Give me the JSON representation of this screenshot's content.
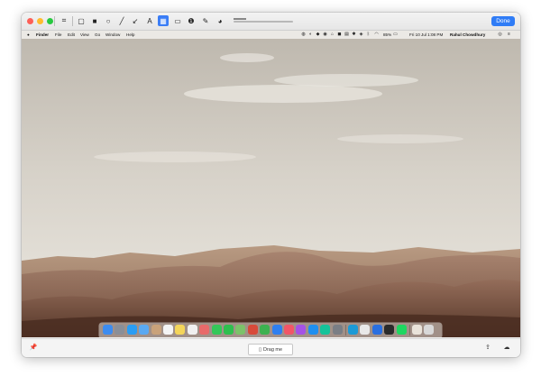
{
  "toolbar": {
    "done_label": "Done",
    "tools": [
      {
        "name": "crop-icon",
        "glyph": "⌗"
      },
      {
        "name": "rectangle-outline-icon",
        "glyph": "▢"
      },
      {
        "name": "rectangle-filled-icon",
        "glyph": "■"
      },
      {
        "name": "ellipse-icon",
        "glyph": "○"
      },
      {
        "name": "line-icon",
        "glyph": "╱"
      },
      {
        "name": "arrow-icon",
        "glyph": "↙"
      },
      {
        "name": "text-icon",
        "glyph": "A"
      },
      {
        "name": "blur-icon",
        "glyph": "▦"
      },
      {
        "name": "highlight-icon",
        "glyph": "▭"
      },
      {
        "name": "counter-icon",
        "glyph": "❶"
      },
      {
        "name": "pencil-icon",
        "glyph": "✎"
      },
      {
        "name": "color-picker-icon",
        "glyph": "◕"
      }
    ]
  },
  "menubar": {
    "apple": "",
    "app_name": "Finder",
    "items": [
      "File",
      "Edit",
      "View",
      "Go",
      "Window",
      "Help"
    ],
    "battery": "85%",
    "datetime": "Fri 10 Jul  1:08 PM",
    "user": "Rahul Chowdhury"
  },
  "bottom": {
    "drag_label": "Drag me",
    "pin_icon": "pin-icon",
    "share_icon": "share-icon",
    "upload_icon": "cloud-upload-icon"
  },
  "colors": {
    "accent": "#2f7cf6",
    "close": "#fd5f57",
    "minimize": "#febc2e",
    "zoom": "#28c840"
  },
  "dock": {
    "apps": [
      {
        "name": "finder-icon",
        "color": "#3d8cf0"
      },
      {
        "name": "launchpad-icon",
        "color": "#8a8f98"
      },
      {
        "name": "safari-icon",
        "color": "#2a9df4"
      },
      {
        "name": "mail-icon",
        "color": "#5aa9f2"
      },
      {
        "name": "contacts-icon",
        "color": "#c9a27a"
      },
      {
        "name": "calendar-icon",
        "color": "#f4f4f4"
      },
      {
        "name": "notes-icon",
        "color": "#f4d55a"
      },
      {
        "name": "reminders-icon",
        "color": "#f0f0f0"
      },
      {
        "name": "photos-icon",
        "color": "#e86a6a"
      },
      {
        "name": "messages-icon",
        "color": "#34c759"
      },
      {
        "name": "facetime-icon",
        "color": "#2fbf4f"
      },
      {
        "name": "maps-icon",
        "color": "#7cc26a"
      },
      {
        "name": "photo-booth-icon",
        "color": "#d84a3a"
      },
      {
        "name": "numbers-icon",
        "color": "#3db150"
      },
      {
        "name": "keynote-icon",
        "color": "#2f7ff0"
      },
      {
        "name": "music-icon",
        "color": "#f25667"
      },
      {
        "name": "podcasts-icon",
        "color": "#a552e6"
      },
      {
        "name": "app-store-icon",
        "color": "#1f8ff0"
      },
      {
        "name": "grammarly-icon",
        "color": "#15c39a"
      },
      {
        "name": "system-preferences-icon",
        "color": "#7a7e85"
      },
      {
        "name": "edge-icon",
        "color": "#1c9ad6"
      },
      {
        "name": "slack-icon",
        "color": "#e8e8e8"
      },
      {
        "name": "todo-icon",
        "color": "#2a6fe0"
      },
      {
        "name": "terminal-icon",
        "color": "#2b2b2b"
      },
      {
        "name": "spotify-icon",
        "color": "#1ed760"
      },
      {
        "name": "documents-icon",
        "color": "#e9e3da"
      },
      {
        "name": "trash-icon",
        "color": "#d8d8d8"
      }
    ]
  }
}
